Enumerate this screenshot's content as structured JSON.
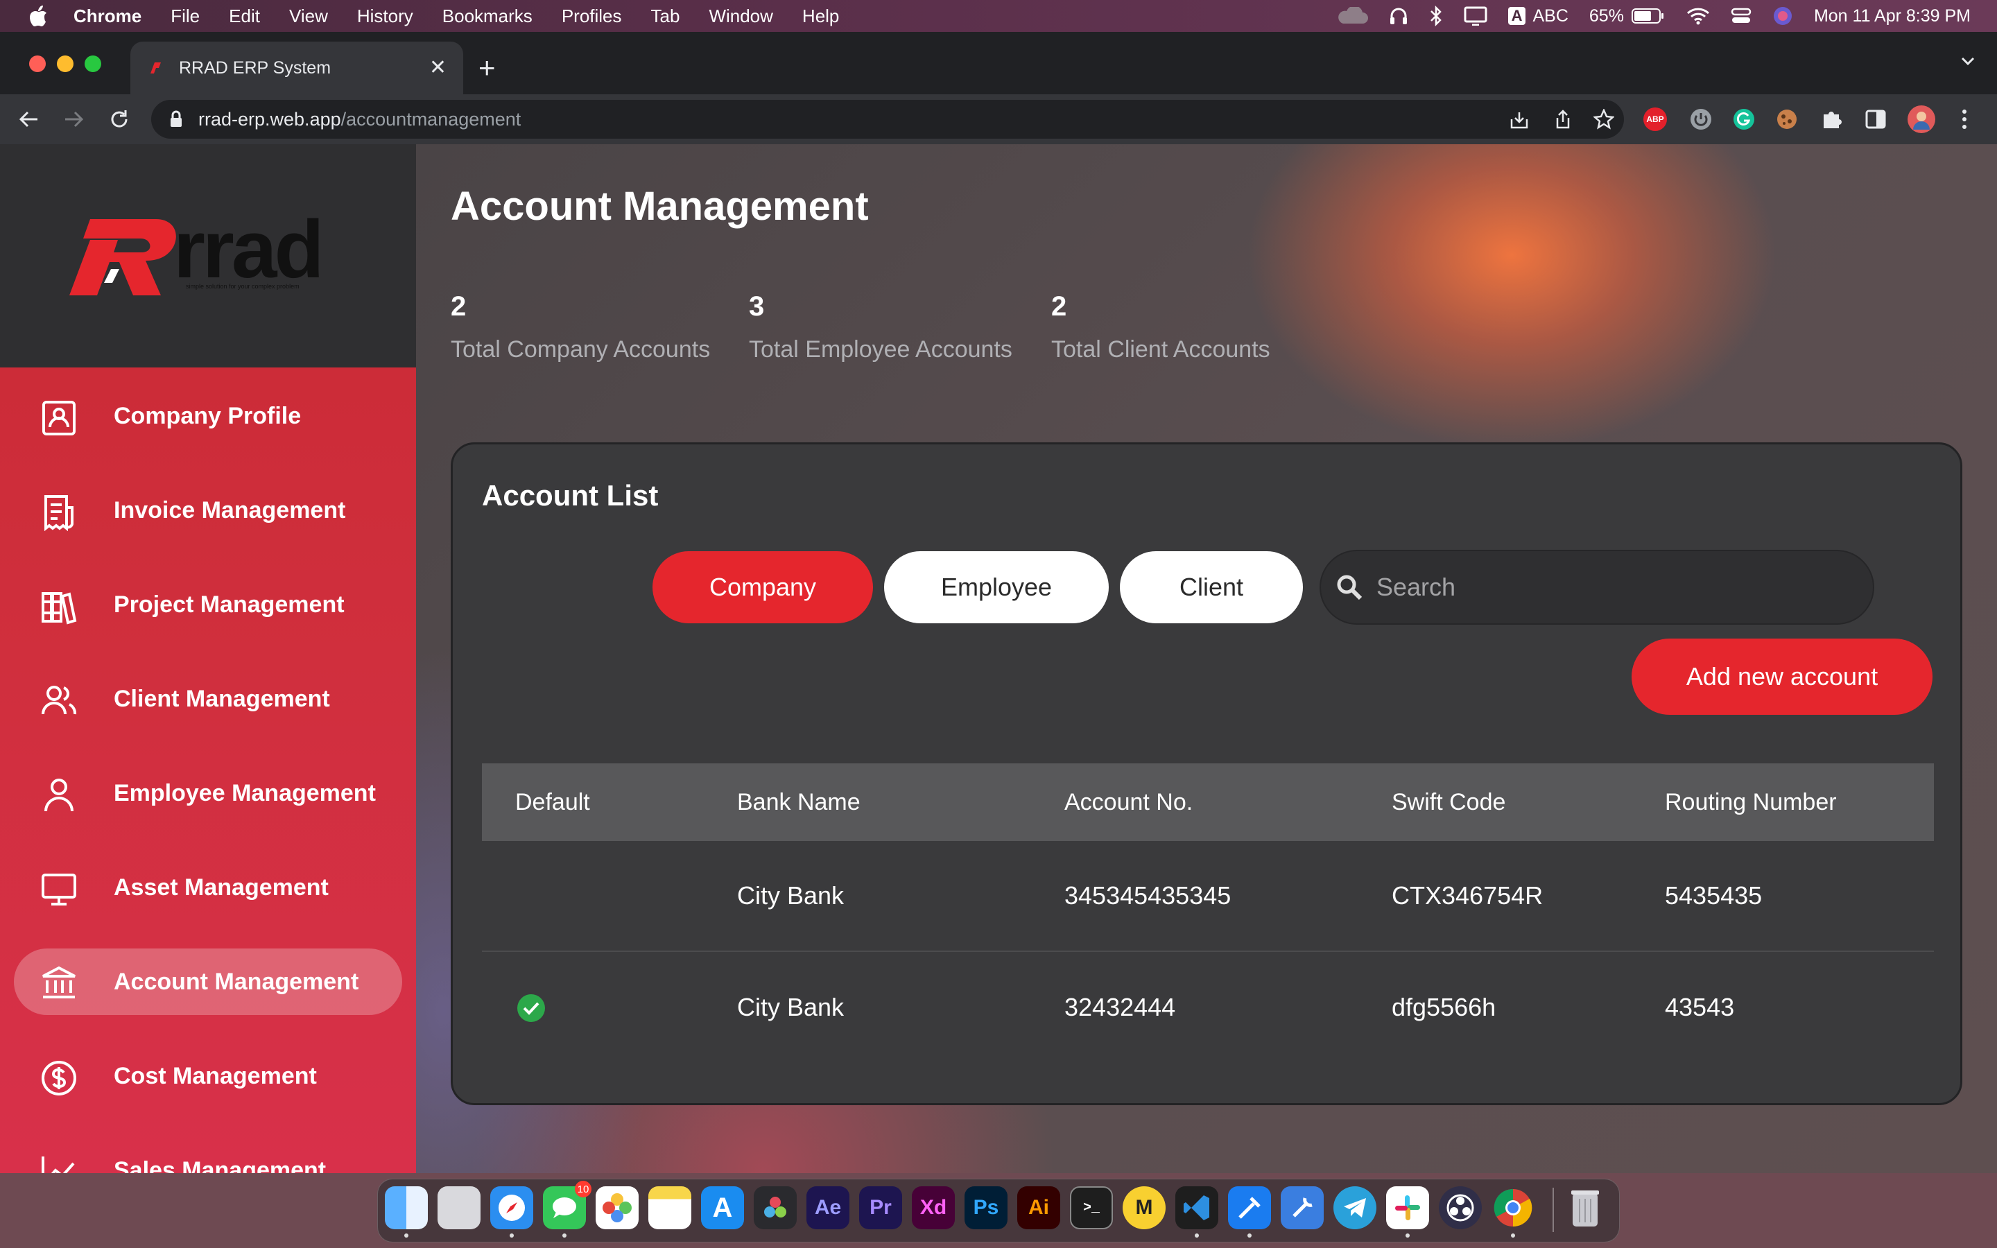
{
  "menubar": {
    "app_name": "Chrome",
    "items": [
      "File",
      "Edit",
      "View",
      "History",
      "Bookmarks",
      "Profiles",
      "Tab",
      "Window",
      "Help"
    ],
    "status": {
      "input_source": "ABC",
      "battery": "65%",
      "datetime": "Mon 11 Apr  8:39 PM"
    }
  },
  "browser": {
    "tab_title": "RRAD ERP System",
    "url_host": "rrad-erp.web.app",
    "url_path": "/accountmanagement",
    "extension_abp": "ABP"
  },
  "sidebar": {
    "logo_text": "rrad",
    "logo_tagline": "simple solution for your complex problem",
    "items": [
      {
        "label": "Company Profile",
        "icon": "company-profile-icon"
      },
      {
        "label": "Invoice Management",
        "icon": "invoice-icon"
      },
      {
        "label": "Project Management",
        "icon": "project-icon"
      },
      {
        "label": "Client Management",
        "icon": "clients-icon"
      },
      {
        "label": "Employee Management",
        "icon": "employee-icon"
      },
      {
        "label": "Asset Management",
        "icon": "monitor-icon"
      },
      {
        "label": "Account Management",
        "icon": "bank-icon",
        "active": true
      },
      {
        "label": "Cost Management",
        "icon": "dollar-icon"
      },
      {
        "label": "Sales Management",
        "icon": "chart-icon"
      }
    ]
  },
  "main": {
    "title": "Account Management",
    "stats": [
      {
        "value": "2",
        "label": "Total Company Accounts"
      },
      {
        "value": "3",
        "label": "Total Employee Accounts"
      },
      {
        "value": "2",
        "label": "Total Client Accounts"
      }
    ],
    "card": {
      "title": "Account List",
      "tabs": [
        "Company",
        "Employee",
        "Client"
      ],
      "active_tab": "Company",
      "search_placeholder": "Search",
      "add_button": "Add new account",
      "columns": [
        "Default",
        "Bank Name",
        "Account No.",
        "Swift Code",
        "Routing Number"
      ],
      "rows": [
        {
          "default": false,
          "bank_name": "City Bank",
          "account_no": "345345435345",
          "swift_code": "CTX346754R",
          "routing_number": "5435435"
        },
        {
          "default": true,
          "bank_name": "City Bank",
          "account_no": "32432444",
          "swift_code": "dfg5566h",
          "routing_number": "43543"
        }
      ]
    }
  },
  "dock": {
    "apps": [
      "Finder",
      "Launchpad",
      "Safari",
      "Messages",
      "Photos",
      "Notes",
      "App Store",
      "DaVinci Resolve",
      "After Effects",
      "Premiere Pro",
      "Adobe XD",
      "Photoshop",
      "Illustrator",
      "Terminal",
      "Miro",
      "VS Code",
      "Xcode",
      "Instruments",
      "Telegram",
      "Slack",
      "OBS",
      "Chrome",
      "Trash"
    ],
    "labels": {
      "ae": "Ae",
      "pr": "Pr",
      "xd": "Xd",
      "ps": "Ps",
      "ai": "Ai"
    },
    "messages_badge": "10"
  },
  "colors": {
    "accent": "#e5262d",
    "sidebar": "#d02f3d",
    "card": "#3a3a3c"
  }
}
